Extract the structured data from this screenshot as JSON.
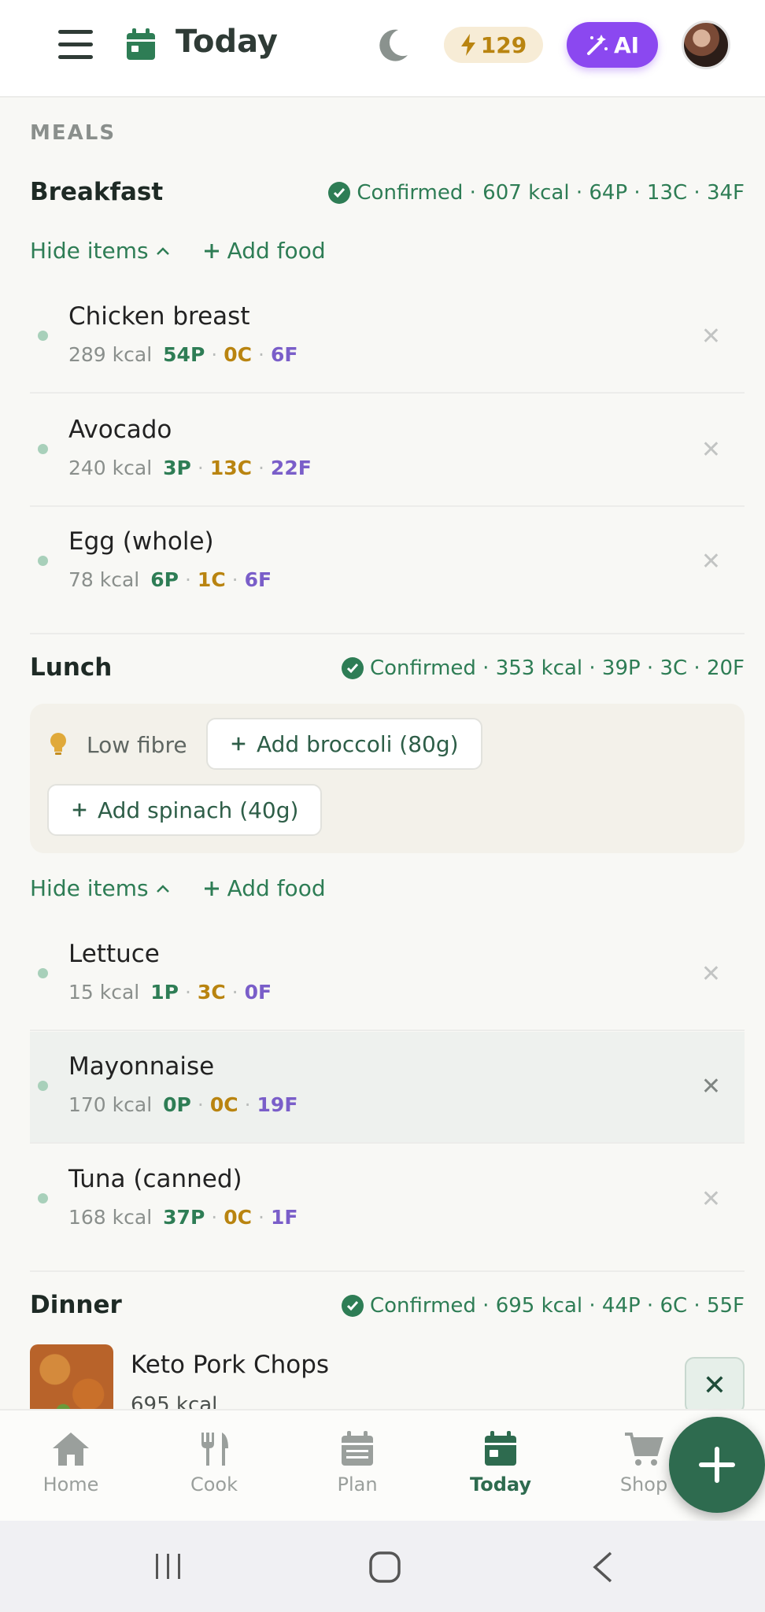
{
  "header": {
    "title": "Today",
    "streak": "129",
    "ai_label": "AI"
  },
  "section_label": "MEALS",
  "links": {
    "hide_items": "Hide items",
    "add_food": "Add food"
  },
  "meals": [
    {
      "title": "Breakfast",
      "summary": "Confirmed · 607 kcal · 64P · 13C · 34F",
      "items": [
        {
          "name": "Chicken breast",
          "kcal": "289 kcal",
          "p": "54P",
          "c": "0C",
          "f": "6F"
        },
        {
          "name": "Avocado",
          "kcal": "240 kcal",
          "p": "3P",
          "c": "13C",
          "f": "22F"
        },
        {
          "name": "Egg (whole)",
          "kcal": "78 kcal",
          "p": "6P",
          "c": "1C",
          "f": "6F"
        }
      ]
    },
    {
      "title": "Lunch",
      "summary": "Confirmed · 353 kcal · 39P · 3C · 20F",
      "tip": {
        "text": "Low fibre",
        "chips": [
          "Add broccoli (80g)",
          "Add spinach (40g)"
        ]
      },
      "items": [
        {
          "name": "Lettuce",
          "kcal": "15 kcal",
          "p": "1P",
          "c": "3C",
          "f": "0F"
        },
        {
          "name": "Mayonnaise",
          "kcal": "170 kcal",
          "p": "0P",
          "c": "0C",
          "f": "19F"
        },
        {
          "name": "Tuna (canned)",
          "kcal": "168 kcal",
          "p": "37P",
          "c": "0C",
          "f": "1F"
        }
      ]
    },
    {
      "title": "Dinner",
      "summary": "Confirmed · 695 kcal · 44P · 6C · 55F",
      "recipe": {
        "name": "Keto Pork Chops",
        "kcal": "695 kcal"
      }
    }
  ],
  "nav": [
    {
      "label": "Home",
      "icon": "home-icon"
    },
    {
      "label": "Cook",
      "icon": "utensils-icon"
    },
    {
      "label": "Plan",
      "icon": "calendar-icon"
    },
    {
      "label": "Today",
      "icon": "calendar-today-icon",
      "active": true
    },
    {
      "label": "Shop",
      "icon": "cart-icon"
    }
  ],
  "colors": {
    "primary": "#2e7d55",
    "ai": "#8b48f0",
    "streak": "#b98410",
    "fat": "#7a5ec9"
  }
}
